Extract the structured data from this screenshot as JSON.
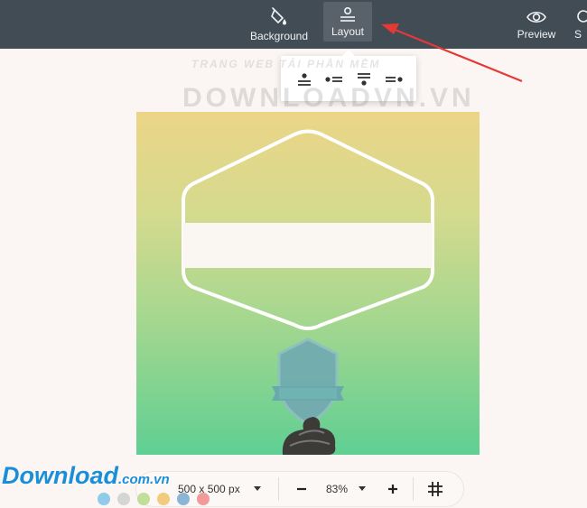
{
  "toolbar": {
    "background_label": "Background",
    "layout_label": "Layout",
    "preview_label": "Preview",
    "more_label": "S"
  },
  "layout_menu": {
    "options": [
      "center-stacked",
      "left-aligned",
      "top-aligned",
      "right-aligned"
    ]
  },
  "watermark": {
    "tagline": "TRANG WEB TẢI PHẦN MỀM",
    "big": "DOWNLOADVN.VN"
  },
  "canvas": {
    "gradient_colors": [
      "#ecd587",
      "#a6d78f",
      "#5fcf93"
    ]
  },
  "bottom_bar": {
    "size_label": "500 x 500 px",
    "zoom_label": "83%"
  },
  "brand": {
    "main": "Download",
    "sub": ".com.vn",
    "dot_colors": [
      "#7cc3e8",
      "#cfcfcf",
      "#b6d98a",
      "#f1c36a",
      "#78a8cf",
      "#ef8a8a"
    ]
  },
  "colors": {
    "toolbar_bg": "#424c55",
    "arrow": "#e53935"
  }
}
